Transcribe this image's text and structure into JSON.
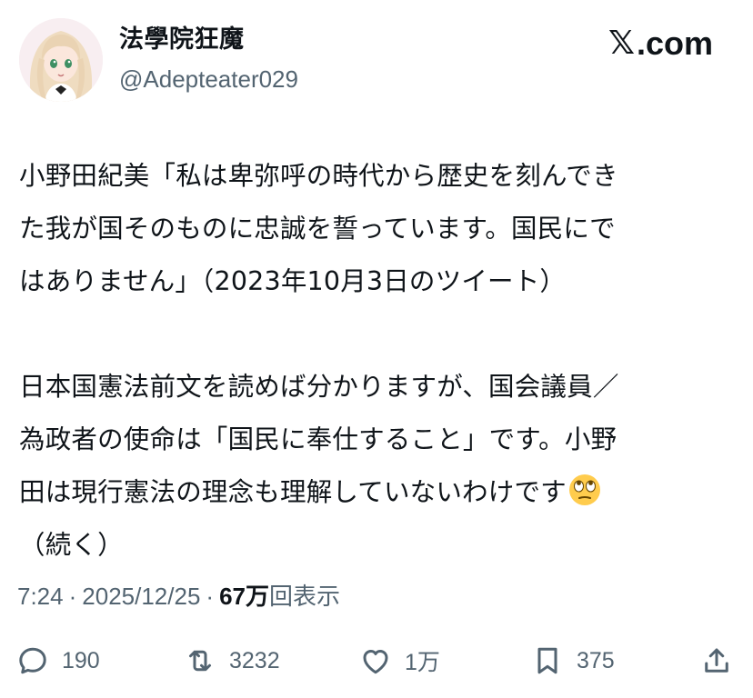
{
  "post": {
    "author": {
      "display_name": "法學院狂魔",
      "handle": "@Adepteater029"
    },
    "brand": {
      "glyph": "𝕏",
      "suffix": ".com"
    },
    "body_lines": [
      "小野田紀美「私は卑弥呼の時代から歴史を刻んでき",
      "た我が国そのものに忠誠を誓っています。国民にで",
      "はありません」（2023年10月3日のツイート）",
      "",
      "日本国憲法前文を読めば分かりますが、国会議員／",
      "為政者の使命は「国民に奉仕すること」です。小野",
      "田は現行憲法の理念も理解していないわけです",
      "（続く）"
    ],
    "meta": {
      "time": "7:24",
      "date": "2025/12/25",
      "views_count": "67万",
      "views_label": "回表示",
      "separator": "·"
    },
    "actions": {
      "replies": {
        "icon": "reply-icon",
        "count": "190"
      },
      "reposts": {
        "icon": "repost-icon",
        "count": "3232"
      },
      "likes": {
        "icon": "heart-icon",
        "count": "1万"
      },
      "bookmarks": {
        "icon": "bookmark-icon",
        "count": "375"
      },
      "share": {
        "icon": "share-icon"
      }
    }
  },
  "colors": {
    "text": "#0f1419",
    "secondary": "#536471",
    "background": "#ffffff"
  }
}
